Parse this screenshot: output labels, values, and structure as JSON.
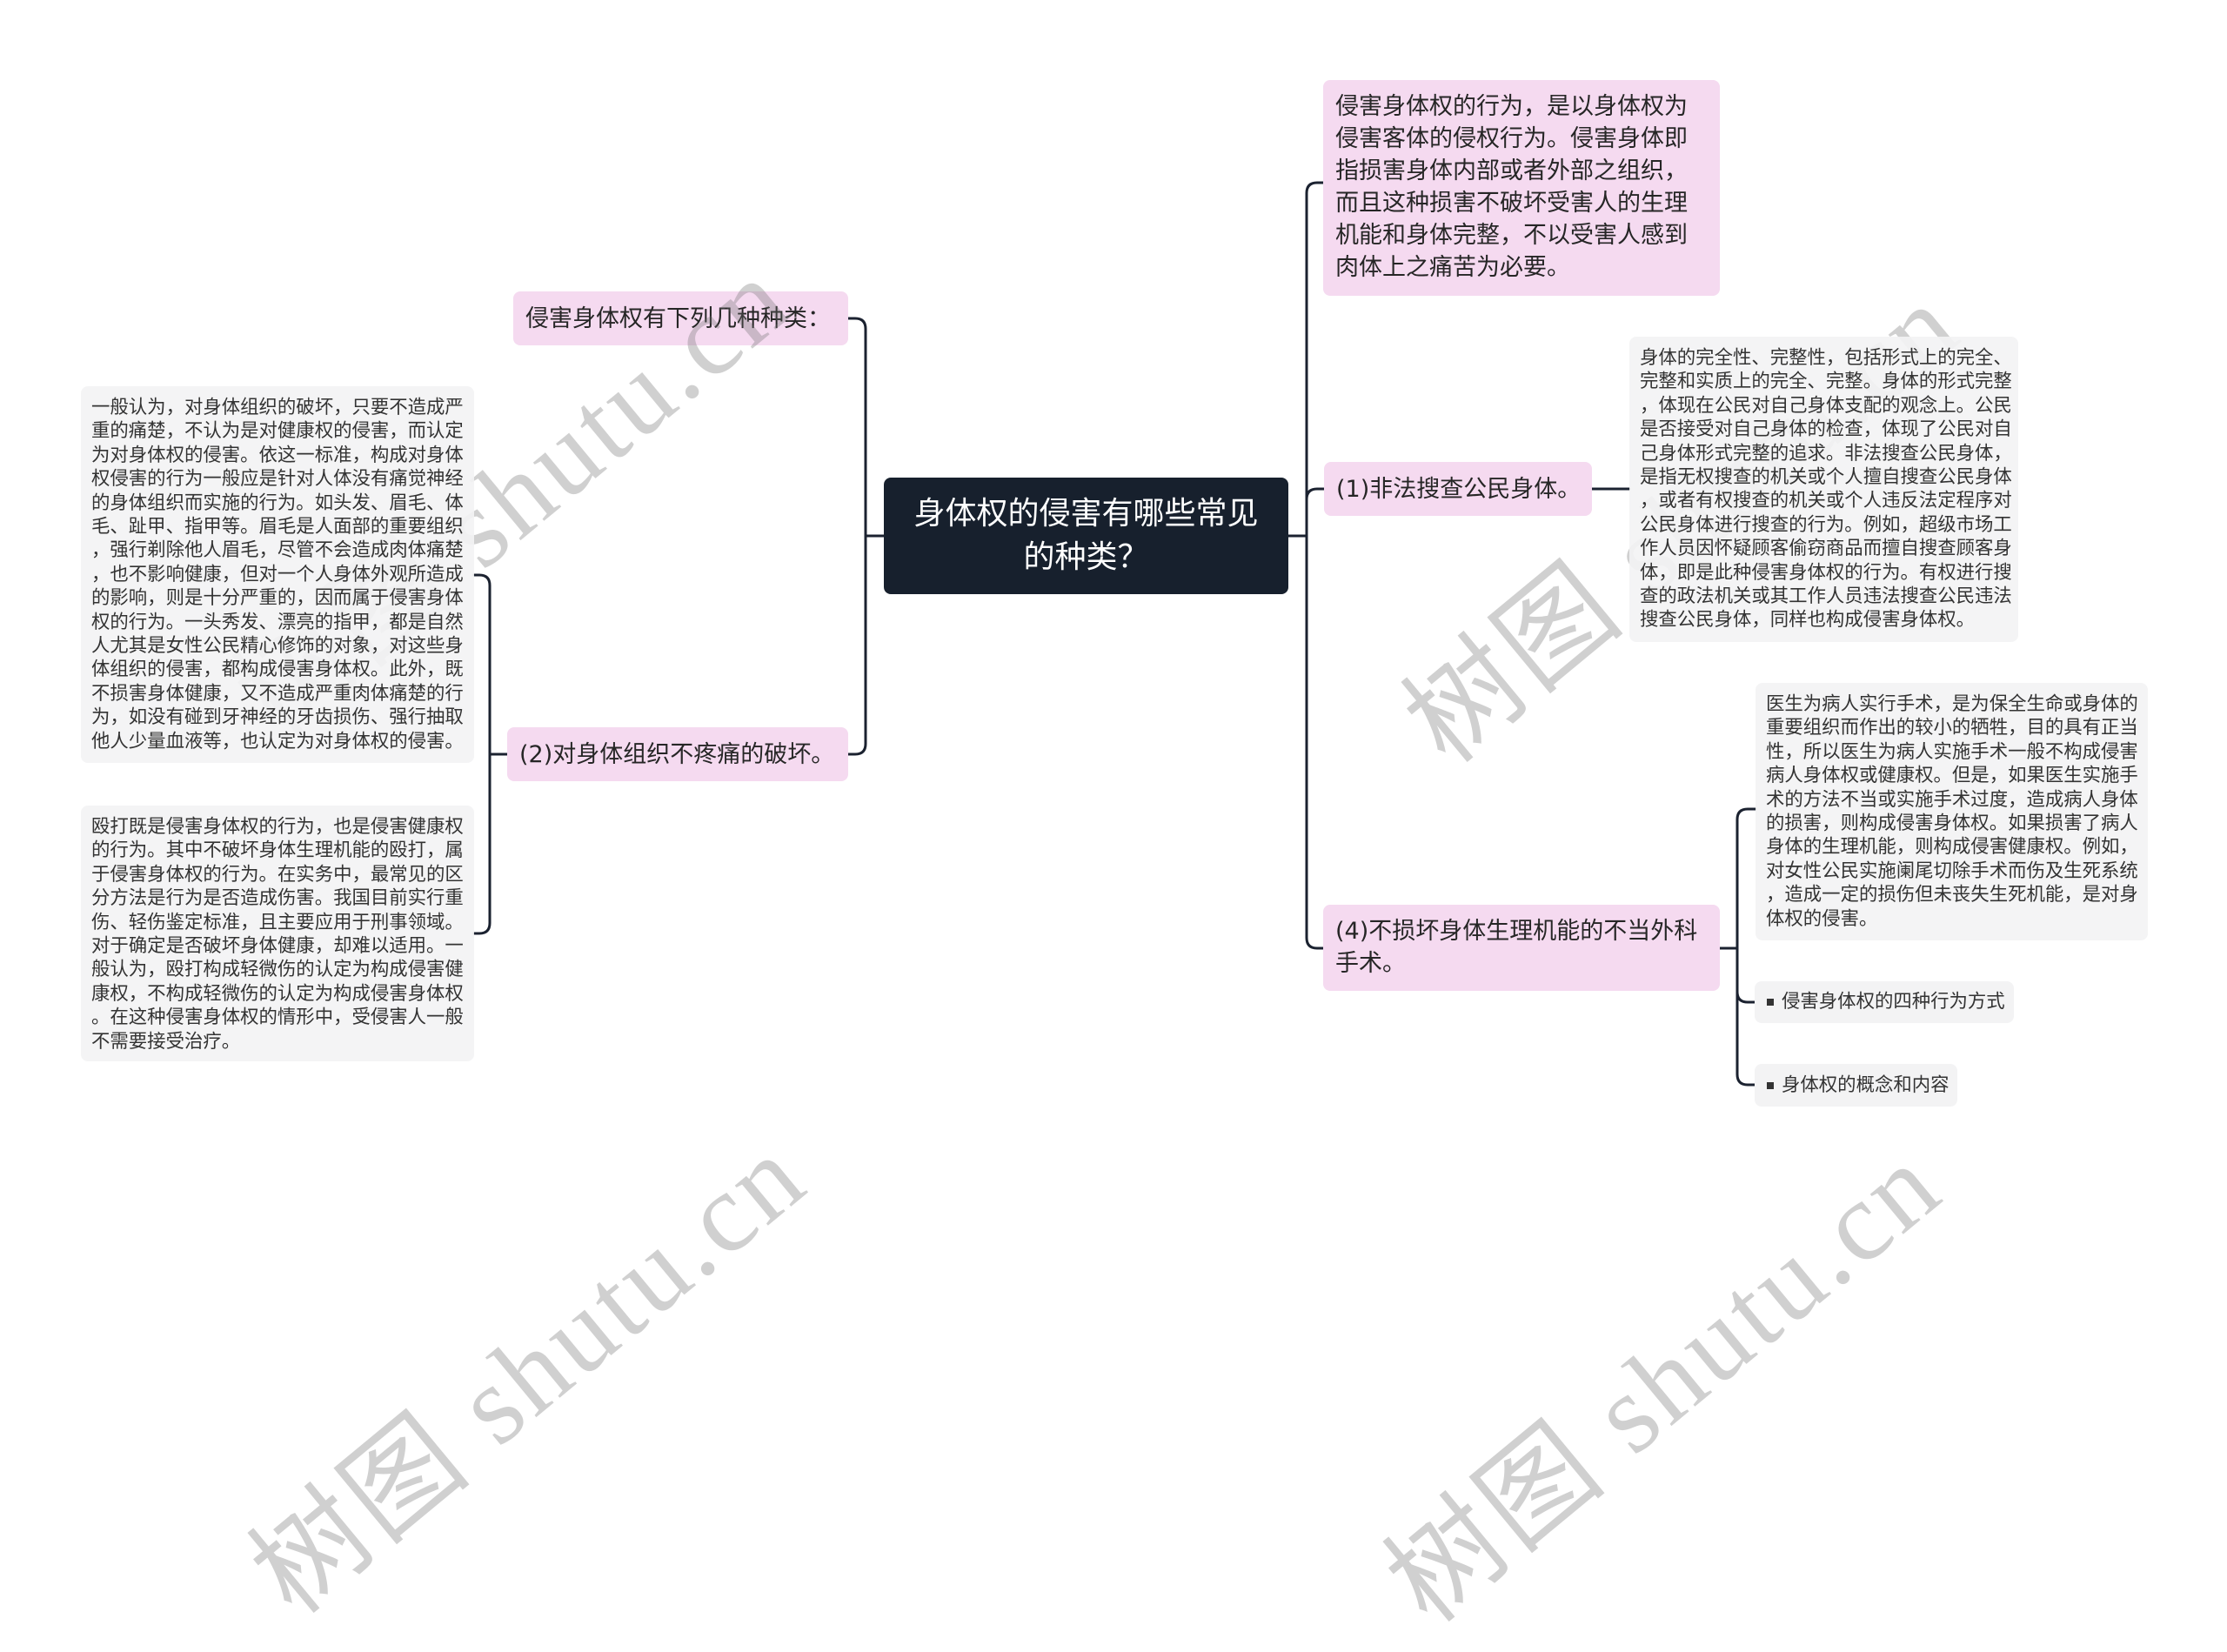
{
  "mindmap": {
    "root": {
      "text": "身体权的侵害有哪些常见\n的种类？"
    },
    "left": [
      {
        "text": "侵害身体权有下列几种种类："
      },
      {
        "text": "(2)对身体组织不疼痛的破坏。",
        "details": [
          {
            "text": "一般认为，对身体组织的破坏，只要不造成严\n重的痛楚，不认为是对健康权的侵害，而认定\n为对身体权的侵害。依这一标准，构成对身体\n权侵害的行为一般应是针对人体没有痛觉神经\n的身体组织而实施的行为。如头发、眉毛、体\n毛、趾甲、指甲等。眉毛是人面部的重要组织\n，强行剃除他人眉毛，尽管不会造成肉体痛楚\n，也不影响健康，但对一个人身体外观所造成\n的影响，则是十分严重的，因而属于侵害身体\n权的行为。一头秀发、漂亮的指甲，都是自然\n人尤其是女性公民精心修饰的对象，对这些身\n体组织的侵害，都构成侵害身体权。此外，既\n不损害身体健康，又不造成严重肉体痛楚的行\n为，如没有碰到牙神经的牙齿损伤、强行抽取\n他人少量血液等，也认定为对身体权的侵害。"
          },
          {
            "text": "殴打既是侵害身体权的行为，也是侵害健康权\n的行为。其中不破坏身体生理机能的殴打，属\n于侵害身体权的行为。在实务中，最常见的区\n分方法是行为是否造成伤害。我国目前实行重\n伤、轻伤鉴定标准，且主要应用于刑事领域。\n对于确定是否破坏身体健康，却难以适用。一\n般认为，殴打构成轻微伤的认定为构成侵害健\n康权，不构成轻微伤的认定为构成侵害身体权\n。在这种侵害身体权的情形中，受侵害人一般\n不需要接受治疗。"
          }
        ]
      }
    ],
    "right": [
      {
        "text": "侵害身体权的行为，是以身体权为\n侵害客体的侵权行为。侵害身体即\n指损害身体内部或者外部之组织，\n而且这种损害不破坏受害人的生理\n机能和身体完整，不以受害人感到\n肉体上之痛苦为必要。"
      },
      {
        "text": "(1)非法搜查公民身体。",
        "details": [
          {
            "text": "身体的完全性、完整性，包括形式上的完全、\n完整和实质上的完全、完整。身体的形式完整\n，体现在公民对自己身体支配的观念上。公民\n是否接受对自己身体的检查，体现了公民对自\n己身体形式完整的追求。非法搜查公民身体，\n是指无权搜查的机关或个人擅自搜查公民身体\n，或者有权搜查的机关或个人违反法定程序对\n公民身体进行搜查的行为。例如，超级市场工\n作人员因怀疑顾客偷窃商品而擅自搜查顾客身\n体，即是此种侵害身体权的行为。有权进行搜\n查的政法机关或其工作人员违法搜查公民违法\n搜查公民身体，同样也构成侵害身体权。"
          }
        ]
      },
      {
        "text": "(4)不损坏身体生理机能的不当外科\n手术。",
        "details": [
          {
            "text": "医生为病人实行手术，是为保全生命或身体的\n重要组织而作出的较小的牺牲，目的具有正当\n性，所以医生为病人实施手术一般不构成侵害\n病人身体权或健康权。但是，如果医生实施手\n术的方法不当或实施手术过度，造成病人身体\n的损害，则构成侵害身体权。如果损害了病人\n身体的生理机能，则构成侵害健康权。例如，\n对女性公民实施阑尾切除手术而伤及生死系统\n，造成一定的损伤但未丧失生死机能，是对身\n体权的侵害。"
          }
        ],
        "links": [
          {
            "icon": "square-bullet",
            "label": "侵害身体权的四种行为方式"
          },
          {
            "icon": "square-bullet",
            "label": "身体权的概念和内容"
          }
        ]
      }
    ]
  },
  "watermark": {
    "text": "树图 shutu.cn"
  },
  "colors": {
    "root_bg": "#17202d",
    "root_text": "#ffffff",
    "branch_bg": "#f5daf0",
    "detail_bg": "#f3f3f4",
    "connector": "#1b2230",
    "text": "#262626"
  }
}
